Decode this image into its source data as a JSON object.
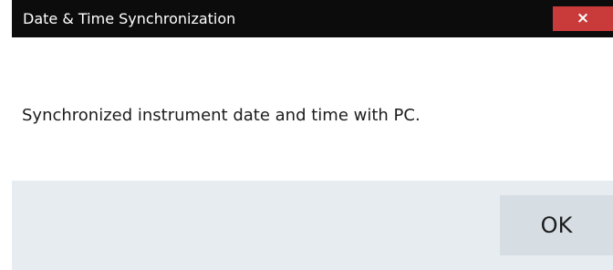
{
  "dialog": {
    "title": "Date & Time Synchronization",
    "close_label": "×",
    "message": "Synchronized instrument date and time with PC.",
    "ok_label": "OK"
  },
  "colors": {
    "titlebar_bg": "#0c0c0c",
    "close_bg": "#c93a3a",
    "footer_bg": "#e7ecf0",
    "button_bg": "#d6dde3"
  }
}
